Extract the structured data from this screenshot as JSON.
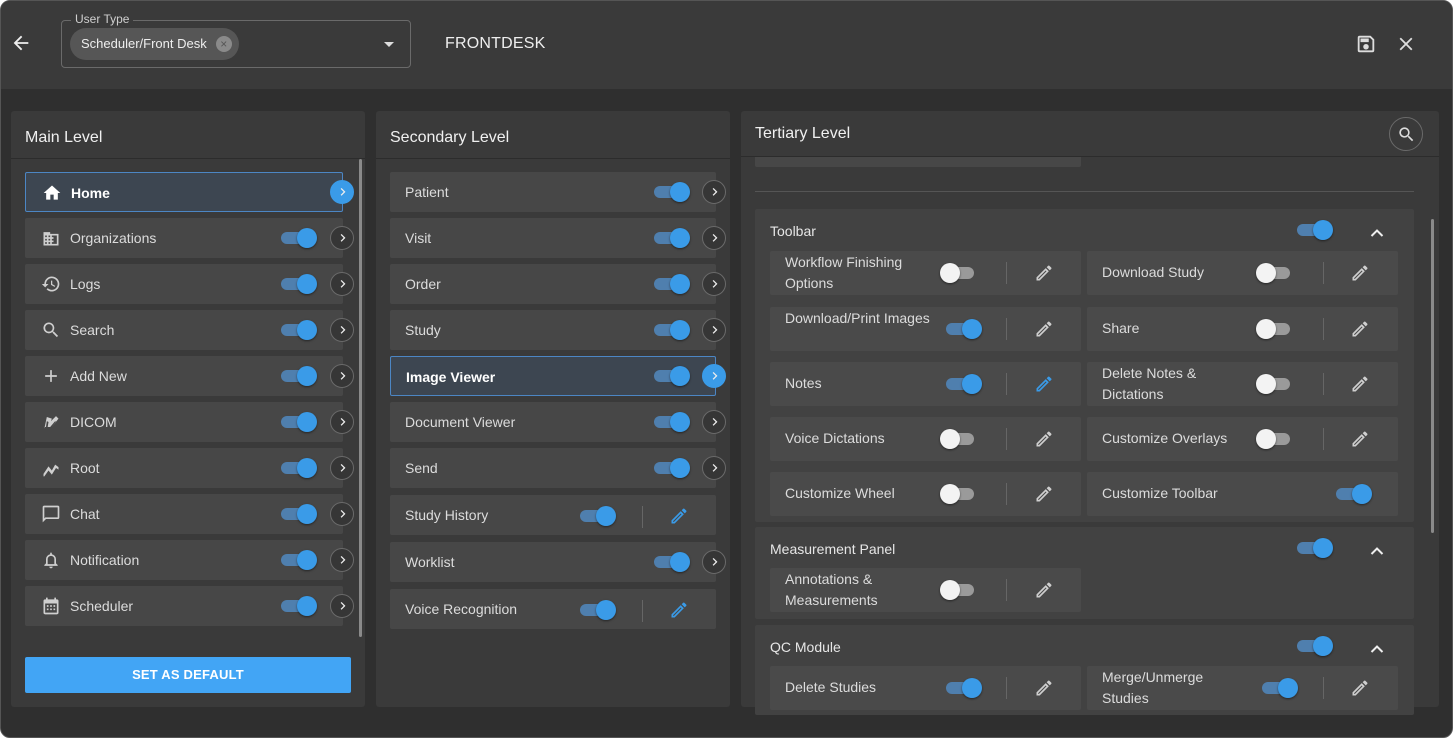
{
  "header": {
    "user_type_legend": "User Type",
    "user_type_value": "Scheduler/Front Desk",
    "page_title": "FRONTDESK",
    "icons": {
      "back": "arrow-left-icon",
      "save": "save-icon",
      "close": "close-icon",
      "clear": "clear-chip-icon",
      "dropdown": "caret-down-icon"
    }
  },
  "main_level": {
    "title": "Main Level",
    "items": [
      {
        "label": "Home",
        "icon": "home-icon",
        "active": true
      },
      {
        "label": "Organizations",
        "icon": "building-icon",
        "enabled": true
      },
      {
        "label": "Logs",
        "icon": "history-icon",
        "enabled": true
      },
      {
        "label": "Search",
        "icon": "search-icon",
        "enabled": true
      },
      {
        "label": "Add New",
        "icon": "plus-icon",
        "enabled": true
      },
      {
        "label": "DICOM",
        "icon": "dicom-icon",
        "enabled": true
      },
      {
        "label": "Root",
        "icon": "chart-line-icon",
        "enabled": true
      },
      {
        "label": "Chat",
        "icon": "chat-icon",
        "enabled": true
      },
      {
        "label": "Notification",
        "icon": "bell-icon",
        "enabled": true
      },
      {
        "label": "Scheduler",
        "icon": "calendar-icon",
        "enabled": true
      }
    ],
    "default_button": "SET AS DEFAULT"
  },
  "secondary_level": {
    "title": "Secondary Level",
    "items": [
      {
        "label": "Patient",
        "enabled": true,
        "action": "arrow"
      },
      {
        "label": "Visit",
        "enabled": true,
        "action": "arrow"
      },
      {
        "label": "Order",
        "enabled": true,
        "action": "arrow"
      },
      {
        "label": "Study",
        "enabled": true,
        "action": "arrow"
      },
      {
        "label": "Image Viewer",
        "enabled": true,
        "action": "arrow",
        "active": true
      },
      {
        "label": "Document Viewer",
        "enabled": true,
        "action": "arrow"
      },
      {
        "label": "Send",
        "enabled": true,
        "action": "arrow"
      },
      {
        "label": "Study History",
        "enabled": true,
        "action": "edit"
      },
      {
        "label": "Worklist",
        "enabled": true,
        "action": "arrow"
      },
      {
        "label": "Voice Recognition",
        "enabled": true,
        "action": "edit"
      }
    ]
  },
  "tertiary_level": {
    "title": "Tertiary Level",
    "search_icon": "search-icon",
    "groups": [
      {
        "title": "Toolbar",
        "enabled": true,
        "expanded": true,
        "items": [
          {
            "label": "Workflow Finishing Options",
            "enabled": false,
            "editable": true
          },
          {
            "label": "Download Study",
            "enabled": false,
            "editable": true
          },
          {
            "label": "Download/Print Images",
            "enabled": true,
            "editable": true
          },
          {
            "label": "Share",
            "enabled": false,
            "editable": true
          },
          {
            "label": "Notes",
            "enabled": true,
            "editable": true,
            "edit_active": true
          },
          {
            "label": "Delete Notes & Dictations",
            "enabled": false,
            "editable": true
          },
          {
            "label": "Voice Dictations",
            "enabled": false,
            "editable": true
          },
          {
            "label": "Customize Overlays",
            "enabled": false,
            "editable": true
          },
          {
            "label": "Customize Wheel",
            "enabled": false,
            "editable": true
          },
          {
            "label": "Customize Toolbar",
            "enabled": true,
            "editable": false
          }
        ]
      },
      {
        "title": "Measurement Panel",
        "enabled": true,
        "expanded": true,
        "items": [
          {
            "label": "Annotations & Measurements",
            "enabled": false,
            "editable": true
          }
        ]
      },
      {
        "title": "QC Module",
        "enabled": true,
        "expanded": true,
        "items": [
          {
            "label": "Delete Studies",
            "enabled": true,
            "editable": true
          },
          {
            "label": "Merge/Unmerge Studies",
            "enabled": true,
            "editable": true
          }
        ]
      }
    ]
  },
  "colors": {
    "accent": "#42a5f5",
    "toggle_on": "#3a9be8",
    "panel": "#3a3a3a",
    "background": "#2f2f2f"
  }
}
